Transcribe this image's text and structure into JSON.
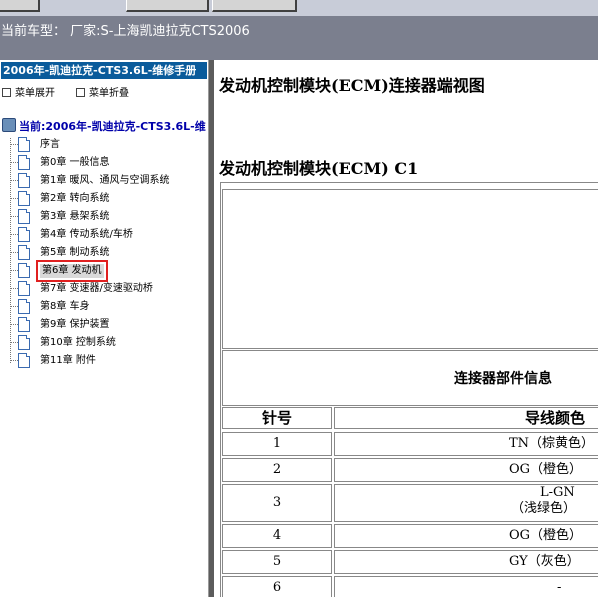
{
  "status_bar": {
    "text": "当前车型：  厂家:S-上海凯迪拉克CTS2006"
  },
  "sidebar": {
    "manual_title": "2006年-凯迪拉克-CTS3.6L-维修手册",
    "expand_label": "菜单展开",
    "collapse_label": "菜单折叠",
    "root_label": "当前:2006年-凯迪拉克-CTS3.6L-维",
    "items": [
      {
        "label": "序言"
      },
      {
        "label": "第0章 一般信息"
      },
      {
        "label": "第1章 暖风、通风与空调系统"
      },
      {
        "label": "第2章 转向系统"
      },
      {
        "label": "第3章 悬架系统"
      },
      {
        "label": "第4章 传动系统/车桥"
      },
      {
        "label": "第5章 制动系统"
      },
      {
        "label": "第6章 发动机",
        "selected": true
      },
      {
        "label": "第7章 变速器/变速驱动桥"
      },
      {
        "label": "第8章 车身"
      },
      {
        "label": "第9章 保护装置"
      },
      {
        "label": "第10章 控制系统"
      },
      {
        "label": "第11章 附件"
      }
    ]
  },
  "content": {
    "page_title": "发动机控制模块(ECM)连接器端视图",
    "section_title": "发动机控制模块(ECM) C1",
    "info_header": "连接器部件信息",
    "table": {
      "headers": [
        "针号",
        "导线颜色"
      ],
      "rows": [
        {
          "pin": "1",
          "color_l1": "TN（棕黄色）",
          "color_l2": ""
        },
        {
          "pin": "2",
          "color_l1": "OG（橙色）",
          "color_l2": ""
        },
        {
          "pin": "3",
          "color_l1": "L-GN",
          "color_l2": "（浅绿色）"
        },
        {
          "pin": "4",
          "color_l1": "OG（橙色）",
          "color_l2": ""
        },
        {
          "pin": "5",
          "color_l1": "GY（灰色）",
          "color_l2": ""
        },
        {
          "pin": "6",
          "color_l1": "-",
          "color_l2": ""
        }
      ]
    }
  },
  "colors": {
    "status_bar_bg": "#7b7f8e",
    "manual_title_bg": "#0a5b9b",
    "selection_outline": "#e02020",
    "divider": "#5c5c5c"
  }
}
